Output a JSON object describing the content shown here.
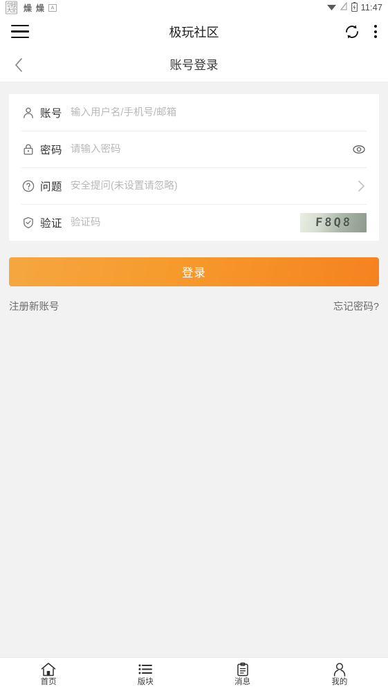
{
  "statusbar": {
    "notifications": [
      {
        "name": "app-notification-icon-1",
        "glyph": "▤"
      },
      {
        "name": "app-notification-icon-2",
        "glyph": "燥"
      },
      {
        "name": "app-notification-icon-3",
        "glyph": "燥"
      },
      {
        "name": "app-notification-icon-4",
        "glyph": "A"
      }
    ],
    "wifi_icon": "wifi-icon",
    "signal_icon": "signal-icon",
    "battery_icon": "battery-icon",
    "time": "11:47"
  },
  "appbar": {
    "menu_icon": "hamburger-menu-icon",
    "title": "极玩社区",
    "refresh_icon": "refresh-icon",
    "overflow_icon": "overflow-menu-icon"
  },
  "subheader": {
    "back_icon": "back-chevron-icon",
    "title": "账号登录"
  },
  "form": {
    "rows": [
      {
        "key": "account",
        "icon": "user-icon",
        "label": "账号",
        "value": "",
        "placeholder": "输入用户名/手机号/邮箱"
      },
      {
        "key": "password",
        "icon": "lock-icon",
        "label": "密码",
        "value": "",
        "placeholder": "请输入密码",
        "trailing_icon": "eye-icon"
      },
      {
        "key": "question",
        "icon": "question-circle-icon",
        "label": "问题",
        "value": "",
        "placeholder": "安全提问(未设置请忽略)",
        "trailing_icon": "chevron-right-icon"
      },
      {
        "key": "captcha",
        "icon": "shield-check-icon",
        "label": "验证",
        "value": "",
        "placeholder": "验证码",
        "captcha_text": "F8Q8"
      }
    ]
  },
  "actions": {
    "login_label": "登录",
    "login_color": "#f58220",
    "register_label": "注册新账号",
    "forgot_label": "忘记密码?"
  },
  "bottomnav": {
    "items": [
      {
        "icon": "home-icon",
        "label": "首页"
      },
      {
        "icon": "list-icon",
        "label": "版块"
      },
      {
        "icon": "clipboard-icon",
        "label": "消息"
      },
      {
        "icon": "person-icon",
        "label": "我的"
      }
    ]
  }
}
